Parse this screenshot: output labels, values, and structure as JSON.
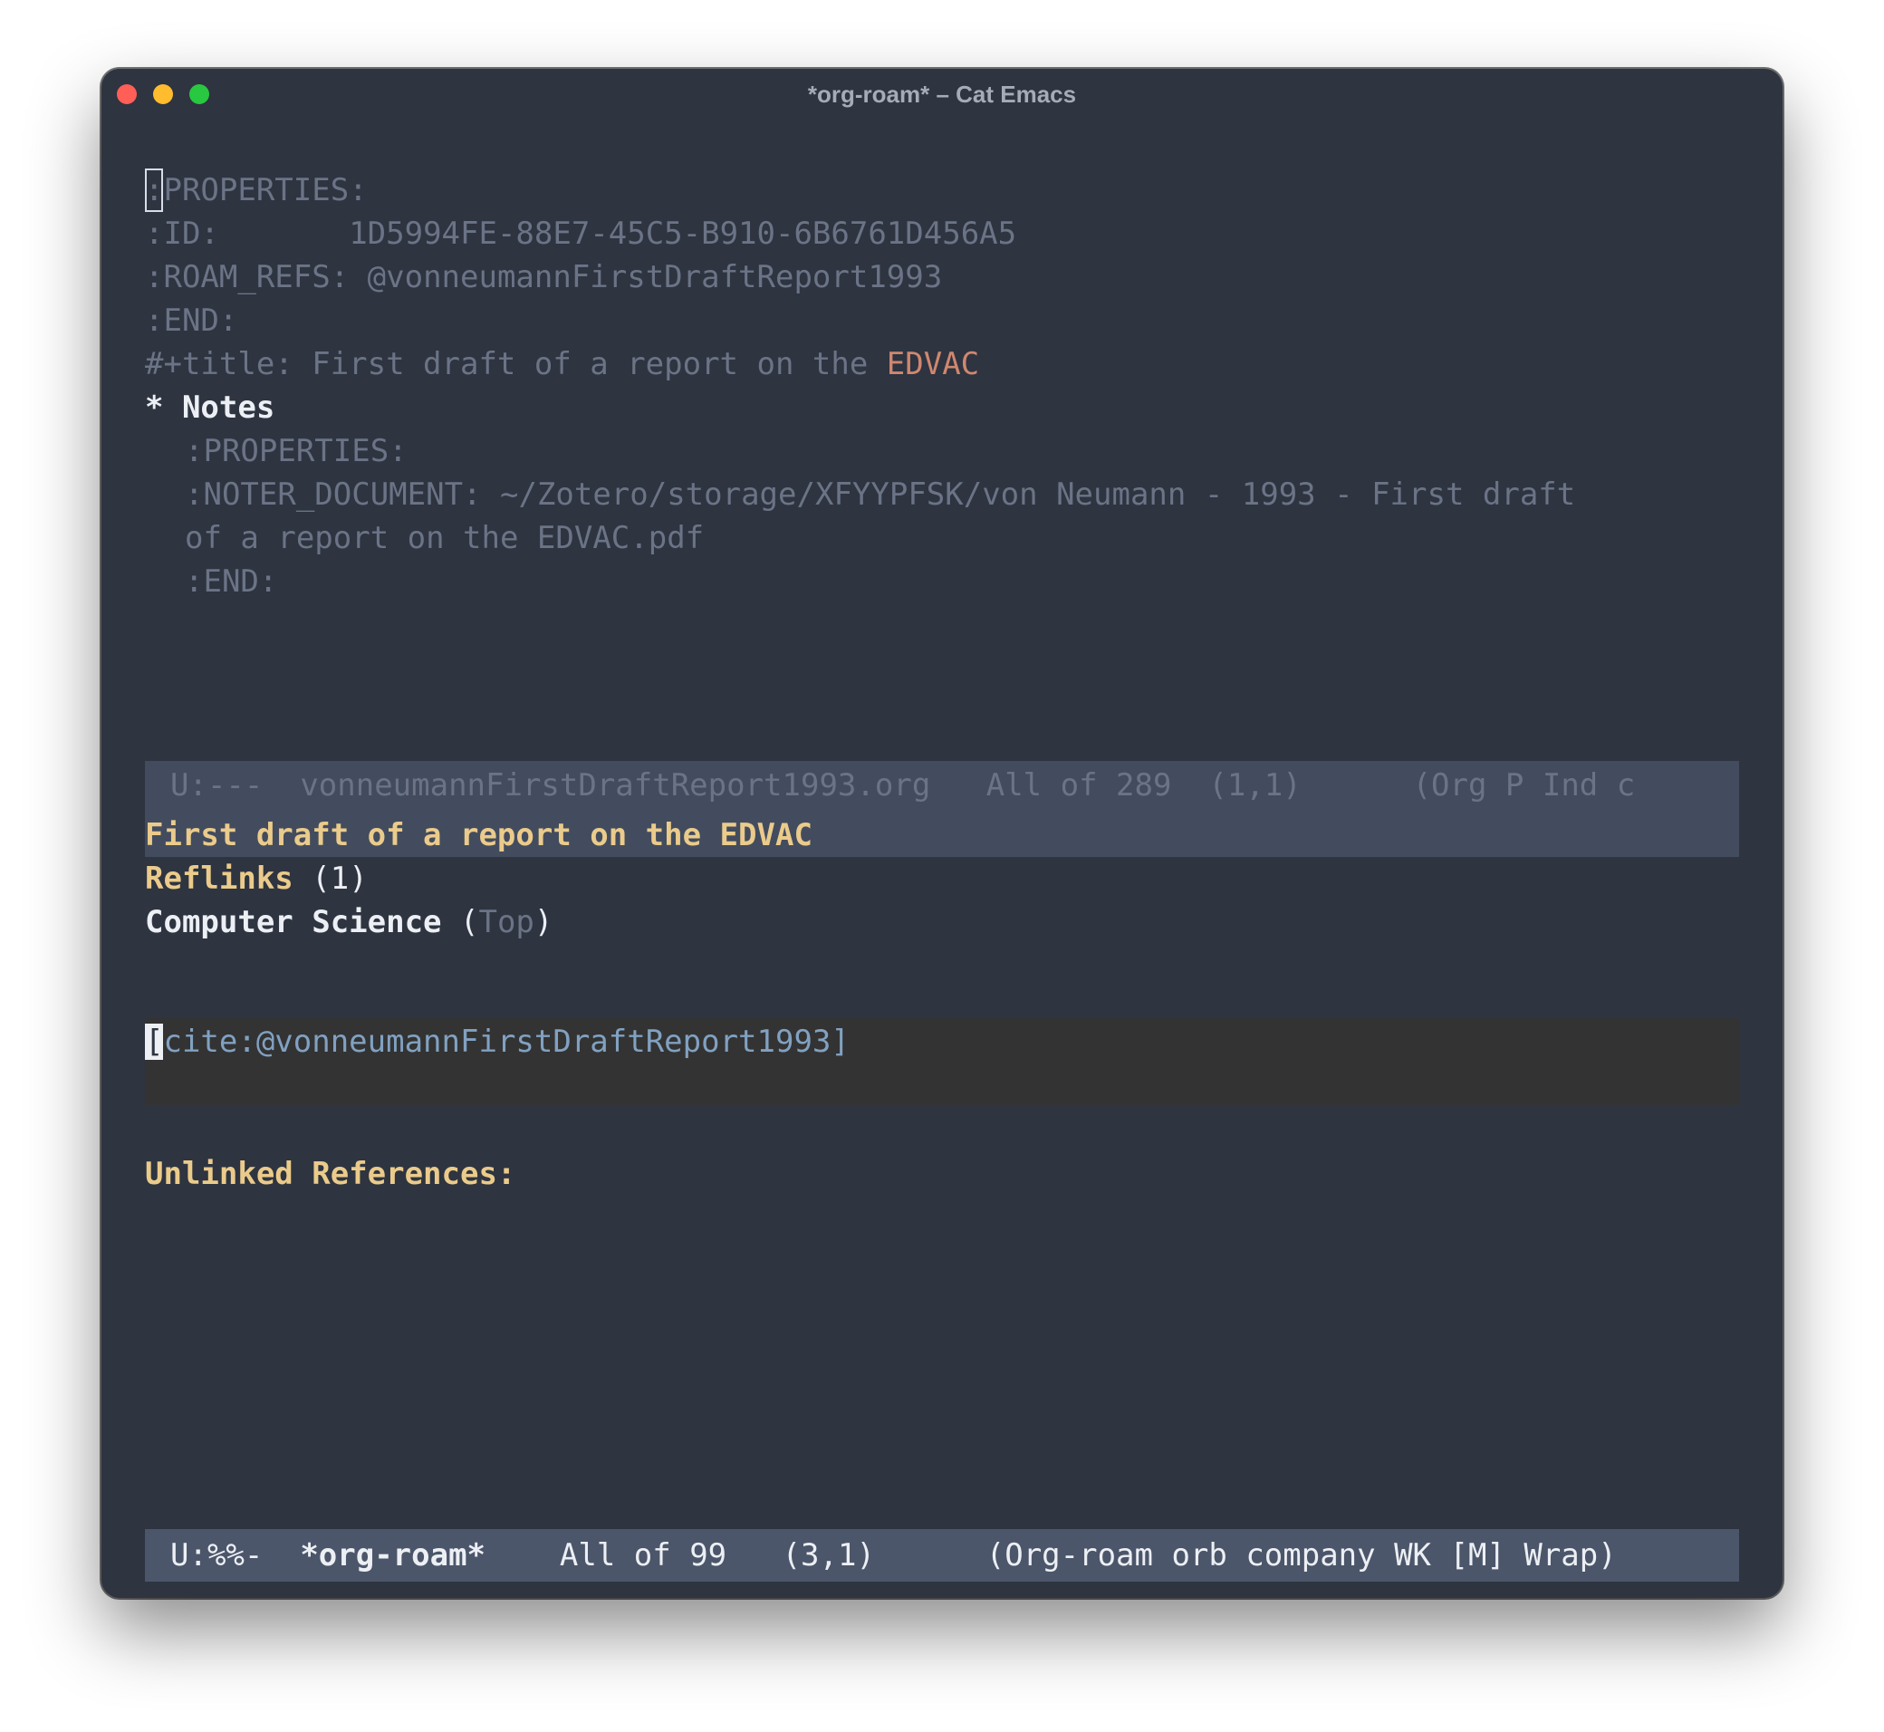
{
  "window": {
    "title": "*org-roam* – Cat Emacs"
  },
  "top_buffer": {
    "lines": {
      "properties_start_cursor": ":",
      "properties_start_rest": "PROPERTIES:",
      "id_key": ":ID:",
      "id_value": "1D5994FE-88E7-45C5-B910-6B6761D456A5",
      "roam_refs_key": ":ROAM_REFS:",
      "roam_refs_value": "@vonneumannFirstDraftReport1993",
      "end": ":END:",
      "title_prefix": "#+title: First draft of a report on the ",
      "title_highlight": "EDVAC",
      "heading": "* Notes",
      "sub_properties_start": ":PROPERTIES:",
      "noter_document_line1": ":NOTER_DOCUMENT: ~/Zotero/storage/XFYYPFSK/von Neumann - 1993 - First draft",
      "noter_document_line2": "of a report on the EDVAC.pdf",
      "sub_end": ":END:"
    },
    "modeline": {
      "state": "U:---",
      "buffer_name": "vonneumannFirstDraftReport1993.org",
      "position": "All of 289",
      "line_col": "(1,1)",
      "modes": "(Org P Ind c"
    }
  },
  "bottom_buffer": {
    "title": "First draft of a report on the EDVAC",
    "reflinks_label": "Reflinks",
    "reflinks_count": "(1)",
    "ref_source_title": "Computer Science",
    "ref_open_paren": "(",
    "ref_outline": "Top",
    "ref_close_paren": ")",
    "cite_cursor": "[",
    "cite_text": "cite:@vonneumannFirstDraftReport1993]",
    "unlinked_label": "Unlinked References:",
    "modeline": {
      "state": "U:%%-",
      "buffer_name": "*org-roam*",
      "position": "All of 99",
      "line_col": "(3,1)",
      "modes": "(Org-roam orb company WK [M] Wrap)"
    }
  },
  "colors": {
    "background": "#2e3440",
    "comment_gray": "#6b7486",
    "heading_yellow": "#ebcb8b",
    "edvac_orange": "#d08770",
    "cite_blue": "#81a1c1",
    "modeline_active": "#4c566a",
    "modeline_inactive": "#434c5e"
  }
}
